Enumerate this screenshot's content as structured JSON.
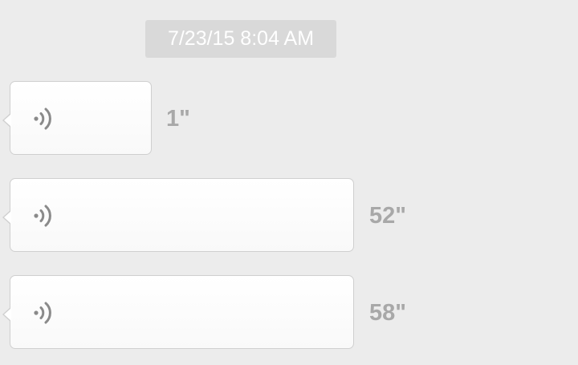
{
  "timestamp": "7/23/15 8:04 AM",
  "voice_messages": [
    {
      "duration": "1\"",
      "icon": "voice-wave-icon"
    },
    {
      "duration": "52\"",
      "icon": "voice-wave-icon"
    },
    {
      "duration": "58\"",
      "icon": "voice-wave-icon"
    }
  ]
}
